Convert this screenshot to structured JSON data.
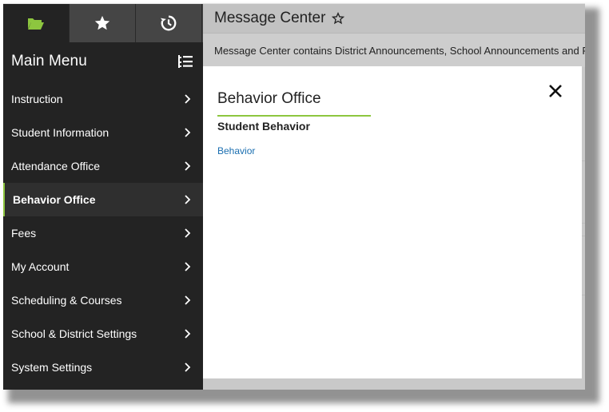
{
  "sidebar": {
    "tabs": [
      {
        "icon": "folder-open-icon",
        "active": true
      },
      {
        "icon": "star-icon",
        "active": false
      },
      {
        "icon": "history-icon",
        "active": false
      }
    ],
    "title": "Main Menu",
    "items": [
      {
        "label": "Instruction"
      },
      {
        "label": "Student Information"
      },
      {
        "label": "Attendance Office"
      },
      {
        "label": "Behavior Office",
        "active": true
      },
      {
        "label": "Fees"
      },
      {
        "label": "My Account"
      },
      {
        "label": "Scheduling & Courses"
      },
      {
        "label": "School & District Settings"
      },
      {
        "label": "System Settings"
      }
    ]
  },
  "header": {
    "title": "Message Center"
  },
  "message_bar": {
    "text": "Message Center contains District Announcements, School Announcements and Pro"
  },
  "panel": {
    "title": "Behavior Office",
    "section_title": "Student Behavior",
    "link": "Behavior"
  },
  "colors": {
    "sidebar_bg": "#232323",
    "accent": "#8dc63f",
    "link": "#1a6eb0"
  }
}
